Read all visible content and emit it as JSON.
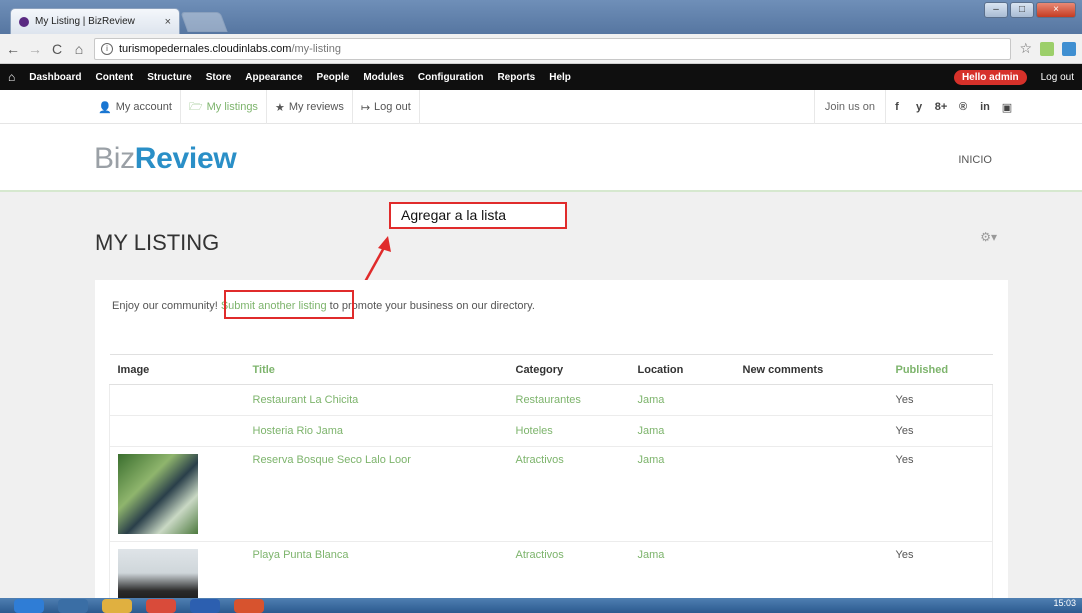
{
  "browser": {
    "tab_title": "My Listing | BizReview",
    "tab_close": "×",
    "url_host": "turismopedernales.cloudinlabs.com",
    "url_path": "/my-listing",
    "back": "←",
    "forward": "→",
    "reload": "C",
    "home": "⌂",
    "star": "☆"
  },
  "toolbar": {
    "items": [
      "Dashboard",
      "Content",
      "Structure",
      "Store",
      "Appearance",
      "People",
      "Modules",
      "Configuration",
      "Reports",
      "Help"
    ],
    "hello": "Hello admin",
    "logout": "Log out"
  },
  "userbar": {
    "links": [
      {
        "icon": "👤",
        "label": "My account"
      },
      {
        "icon": "🗁",
        "label": "My listings"
      },
      {
        "icon": "★",
        "label": "My reviews"
      },
      {
        "icon": "↦",
        "label": "Log out"
      }
    ],
    "join_label": "Join us on",
    "social": [
      "f",
      "y",
      "8+",
      "®",
      "in",
      "▣"
    ]
  },
  "header": {
    "logo_part1": "Biz",
    "logo_part2": "Review",
    "nav_inicio": "INICIO"
  },
  "page": {
    "title": "MY LISTING",
    "gear": "⚙▾",
    "annotation": "Agregar a la lista",
    "intro_before": "Enjoy our community! ",
    "intro_link": "Submit another listing",
    "intro_after": " to promote your business on our directory."
  },
  "table": {
    "headers": [
      "Image",
      "Title",
      "Category",
      "Location",
      "New comments",
      "Published"
    ],
    "rows": [
      {
        "title": "Restaurant La Chicita",
        "category": "Restaurantes",
        "location": "Jama",
        "comments": "",
        "published": "Yes"
      },
      {
        "title": "Hosteria Rio Jama",
        "category": "Hoteles",
        "location": "Jama",
        "comments": "",
        "published": "Yes"
      },
      {
        "title": "Reserva Bosque Seco Lalo Loor",
        "category": "Atractivos",
        "location": "Jama",
        "comments": "",
        "published": "Yes"
      },
      {
        "title": "Playa Punta Blanca",
        "category": "Atractivos",
        "location": "Jama",
        "comments": "",
        "published": "Yes"
      }
    ]
  },
  "taskbar": {
    "clock": "15:03"
  },
  "colors": {
    "green_link": "#7db46c",
    "logo_blue": "#2a8fc7",
    "annotation_red": "#e02b2b",
    "toolbar_bg": "#0f0f0f",
    "hello_badge": "#d6312a"
  }
}
